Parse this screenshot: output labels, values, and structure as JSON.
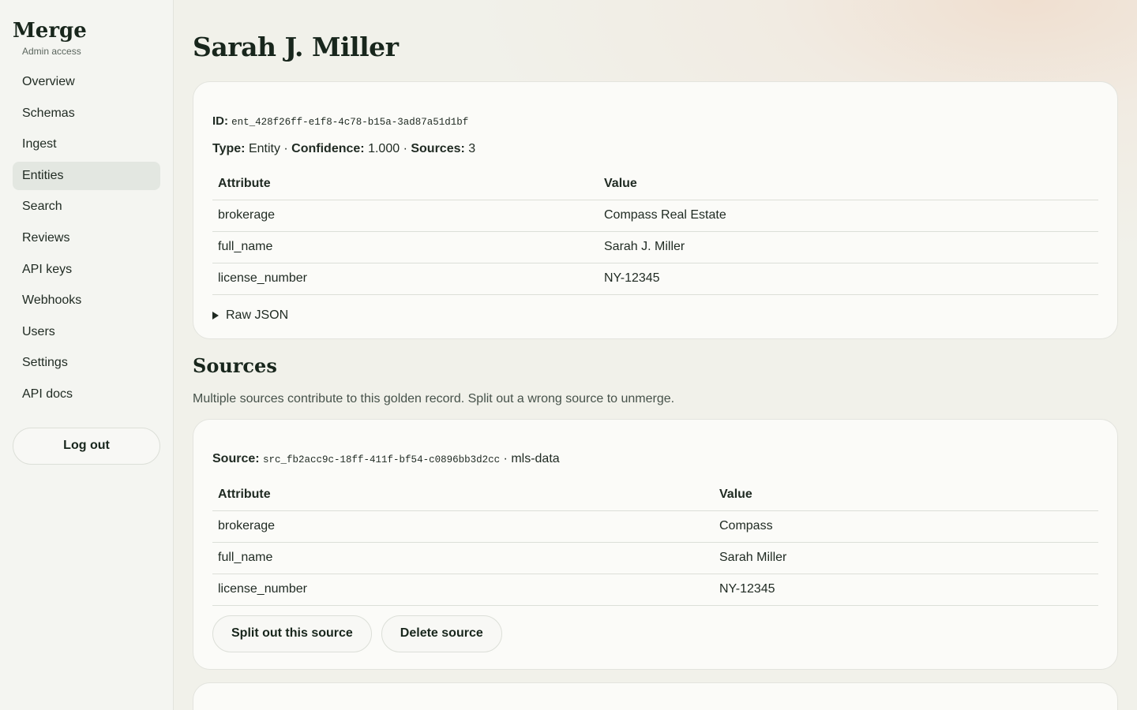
{
  "app": {
    "name": "Merge",
    "subtitle": "Admin access"
  },
  "nav": [
    {
      "label": "Overview"
    },
    {
      "label": "Schemas"
    },
    {
      "label": "Ingest"
    },
    {
      "label": "Entities",
      "active": true
    },
    {
      "label": "Search"
    },
    {
      "label": "Reviews"
    },
    {
      "label": "API keys"
    },
    {
      "label": "Webhooks"
    },
    {
      "label": "Users"
    },
    {
      "label": "Settings"
    },
    {
      "label": "API docs"
    }
  ],
  "logout_label": "Log out",
  "entity": {
    "title": "Sarah J. Miller",
    "id_label": "ID:",
    "id": "ent_428f26ff-e1f8-4c78-b15a-3ad87a51d1bf",
    "type_label": "Type:",
    "type": "Entity",
    "confidence_label": "Confidence:",
    "confidence": "1.000",
    "sources_label": "Sources:",
    "sources_count": "3",
    "separator": " · ",
    "table": {
      "headers": [
        "Attribute",
        "Value"
      ],
      "rows": [
        [
          "brokerage",
          "Compass Real Estate"
        ],
        [
          "full_name",
          "Sarah J. Miller"
        ],
        [
          "license_number",
          "NY-12345"
        ]
      ]
    },
    "raw_json_label": "Raw JSON"
  },
  "sources": {
    "title": "Sources",
    "description": "Multiple sources contribute to this golden record. Split out a wrong source to unmerge.",
    "items": [
      {
        "label": "Source:",
        "id": "src_fb2acc9c-18ff-411f-bf54-c0896bb3d2cc",
        "system": "mls-data",
        "headers": [
          "Attribute",
          "Value"
        ],
        "rows": [
          [
            "brokerage",
            "Compass"
          ],
          [
            "full_name",
            "Sarah Miller"
          ],
          [
            "license_number",
            "NY-12345"
          ]
        ],
        "split_label": "Split out this source",
        "delete_label": "Delete source"
      }
    ]
  }
}
